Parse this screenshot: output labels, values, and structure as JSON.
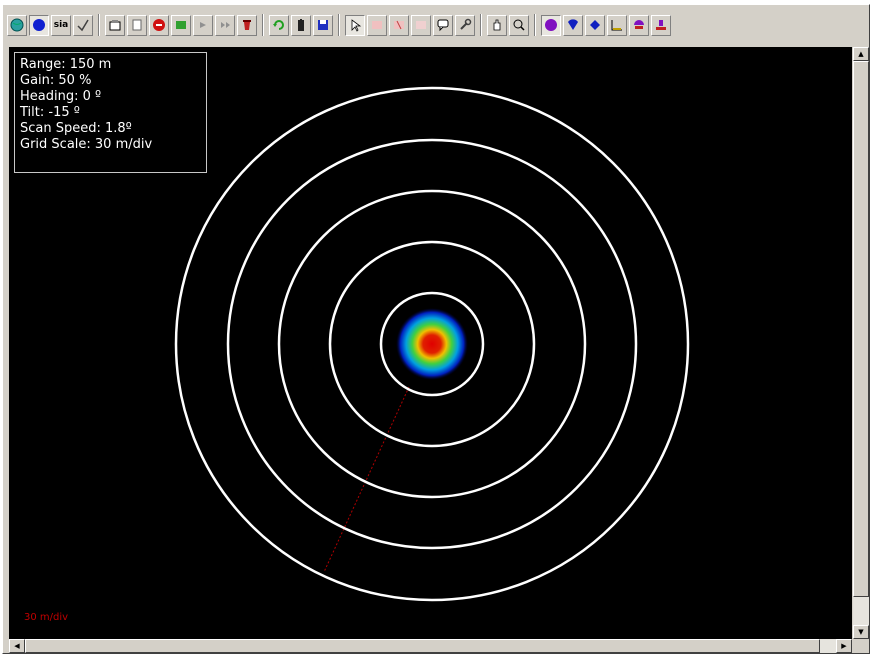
{
  "toolbar": {
    "buttons": [
      {
        "icon": "globe-icon",
        "label": ""
      },
      {
        "icon": "blue-circle-icon",
        "label": ""
      },
      {
        "icon": "text-button-icon",
        "label": "sia"
      },
      {
        "icon": "check-icon",
        "label": ""
      },
      {
        "icon": "open-icon",
        "label": ""
      },
      {
        "icon": "document-icon",
        "label": ""
      },
      {
        "icon": "stop-icon",
        "label": ""
      },
      {
        "icon": "record-icon",
        "label": ""
      },
      {
        "icon": "playback-icon",
        "label": ""
      },
      {
        "icon": "step-icon",
        "label": ""
      },
      {
        "icon": "trash-icon",
        "label": ""
      },
      {
        "icon": "refresh-icon",
        "label": ""
      },
      {
        "icon": "battery-icon",
        "label": ""
      },
      {
        "icon": "save-icon",
        "label": ""
      },
      {
        "icon": "pointer-icon",
        "label": ""
      },
      {
        "icon": "measure-icon",
        "label": ""
      },
      {
        "icon": "marker-icon",
        "label": ""
      },
      {
        "icon": "ruler-icon",
        "label": ""
      },
      {
        "icon": "comment-icon",
        "label": ""
      },
      {
        "icon": "wrench-icon",
        "label": ""
      },
      {
        "icon": "hand-icon",
        "label": ""
      },
      {
        "icon": "zoom-icon",
        "label": ""
      },
      {
        "icon": "circle-view-icon",
        "label": ""
      },
      {
        "icon": "sector-view-icon",
        "label": ""
      },
      {
        "icon": "side-view-icon",
        "label": ""
      },
      {
        "icon": "profile-view-icon",
        "label": ""
      },
      {
        "icon": "sonar-head-icon",
        "label": ""
      },
      {
        "icon": "transducer-icon",
        "label": ""
      }
    ]
  },
  "info": {
    "range": "Range: 150 m",
    "gain": "Gain: 50 %",
    "heading": "Heading: 0 º",
    "tilt": "Tilt: -15 º",
    "scan_speed": "Scan Speed: 1.8º",
    "grid_scale": "Grid Scale: 30 m/div"
  },
  "scale_label": "30 m/div",
  "colors": {
    "background": "#000000",
    "rings": "#ffffff",
    "target_core": "#e00000",
    "heading_line": "#b00000"
  }
}
